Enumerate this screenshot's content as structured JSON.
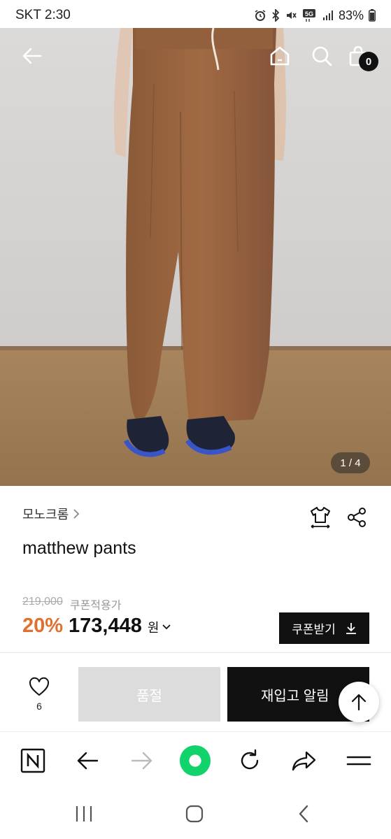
{
  "status_bar": {
    "carrier_time": "SKT 2:30",
    "battery": "83%",
    "icons": [
      "alarm-icon",
      "bluetooth-icon",
      "mute-icon",
      "5g-icon",
      "signal-icon",
      "battery-icon"
    ]
  },
  "hero": {
    "image_counter": "1 / 4",
    "cart_count": "0",
    "icons": [
      "back-arrow-icon",
      "home-icon",
      "search-icon",
      "shopping-bag-icon"
    ]
  },
  "product": {
    "brand": "모노크롬",
    "name": "matthew pants",
    "original_price": "219,000",
    "coupon_note": "쿠폰적용가",
    "discount": "20%",
    "price": "173,448",
    "currency": "원",
    "coupon_button": "쿠폰받기",
    "accent_color": "#e0702c"
  },
  "actions": {
    "like_count": "6",
    "soldout_label": "품절",
    "restock_label": "재입고 알림"
  },
  "browser_toolbar": {
    "icons": [
      "naver-n-icon",
      "back-arrow-icon",
      "forward-arrow-icon",
      "green-home-icon",
      "refresh-icon",
      "share-icon",
      "menu-icon"
    ]
  },
  "system_nav": {
    "icons": [
      "recent-apps-icon",
      "home-circle-icon",
      "back-chevron-icon"
    ]
  }
}
